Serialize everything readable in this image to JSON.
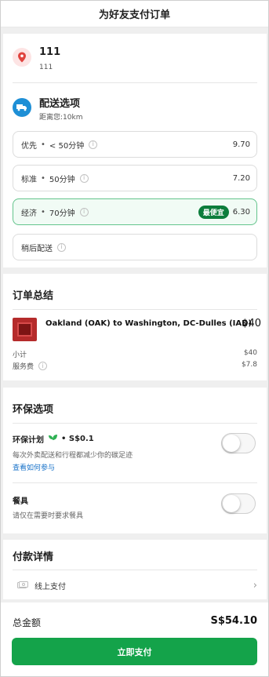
{
  "header": {
    "title": "为好友支付订单"
  },
  "address": {
    "title": "111",
    "subtitle": "111"
  },
  "delivery": {
    "title": "配送选项",
    "distance": "距离您:10km",
    "options": [
      {
        "name": "优先",
        "time": "< 50分钟",
        "price": "9.70",
        "badge": "",
        "selected": false
      },
      {
        "name": "标准",
        "time": "50分钟",
        "price": "7.20",
        "badge": "",
        "selected": false
      },
      {
        "name": "经济",
        "time": "70分钟",
        "price": "6.30",
        "badge": "最便宜",
        "selected": true
      },
      {
        "name": "稍后配送",
        "time": "",
        "price": "",
        "badge": "",
        "selected": false
      }
    ],
    "separator": "•"
  },
  "summary": {
    "title": "订单总结",
    "item_name": "Oakland (OAK) to Washington, DC-Dulles (IAD)",
    "item_price": "$40",
    "subtotal_label": "小计",
    "subtotal_value": "$40",
    "fee_label": "服务费",
    "fee_value": "$7.8"
  },
  "eco": {
    "title": "环保选项",
    "plan_name": "环保计划",
    "plan_price": "• S$0.1",
    "plan_desc": "每次外卖配送和行程都减少你的碳足迹",
    "plan_link": "查看如何参与",
    "plan_enabled": false,
    "tableware_name": "餐具",
    "tableware_desc": "请仅在需要时要求餐具",
    "tableware_enabled": false
  },
  "payment": {
    "title": "付款详情",
    "method": "线上支付"
  },
  "footer": {
    "total_label": "总金额",
    "total_value": "S$54.10",
    "pay_button": "立即支付"
  },
  "colors": {
    "primary_green": "#14a34a",
    "badge_green": "#0d7d3c",
    "link_blue": "#1a73c9",
    "pin_red": "#e0443f",
    "truck_blue": "#1e8fd6"
  },
  "icons": {
    "address": "location-pin-icon",
    "delivery": "truck-icon",
    "info": "info-icon",
    "leaf": "leaf-icon",
    "payment": "cash-icon",
    "chevron": "chevron-right-icon"
  }
}
